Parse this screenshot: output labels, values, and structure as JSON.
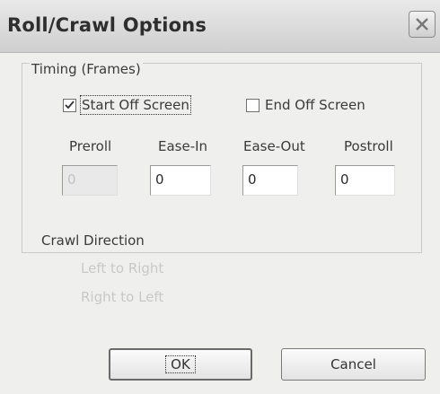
{
  "window": {
    "title": "Roll/Crawl Options"
  },
  "timing": {
    "heading": "Timing (Frames)",
    "start_off_screen": {
      "label": "Start Off Screen",
      "checked": true
    },
    "end_off_screen": {
      "label": "End Off Screen",
      "checked": false
    },
    "fields": [
      {
        "label": "Preroll",
        "value": "0",
        "enabled": false
      },
      {
        "label": "Ease-In",
        "value": "0",
        "enabled": true
      },
      {
        "label": "Ease-Out",
        "value": "0",
        "enabled": true
      },
      {
        "label": "Postroll",
        "value": "0",
        "enabled": true
      }
    ]
  },
  "crawl": {
    "heading": "Crawl Direction",
    "options": [
      {
        "label": "Left to Right",
        "enabled": false
      },
      {
        "label": "Right to Left",
        "enabled": false
      }
    ]
  },
  "buttons": {
    "ok": "OK",
    "cancel": "Cancel"
  },
  "colors": {
    "disabled_text": "#c8c8c8",
    "titlebar": "#d8d8d8"
  }
}
